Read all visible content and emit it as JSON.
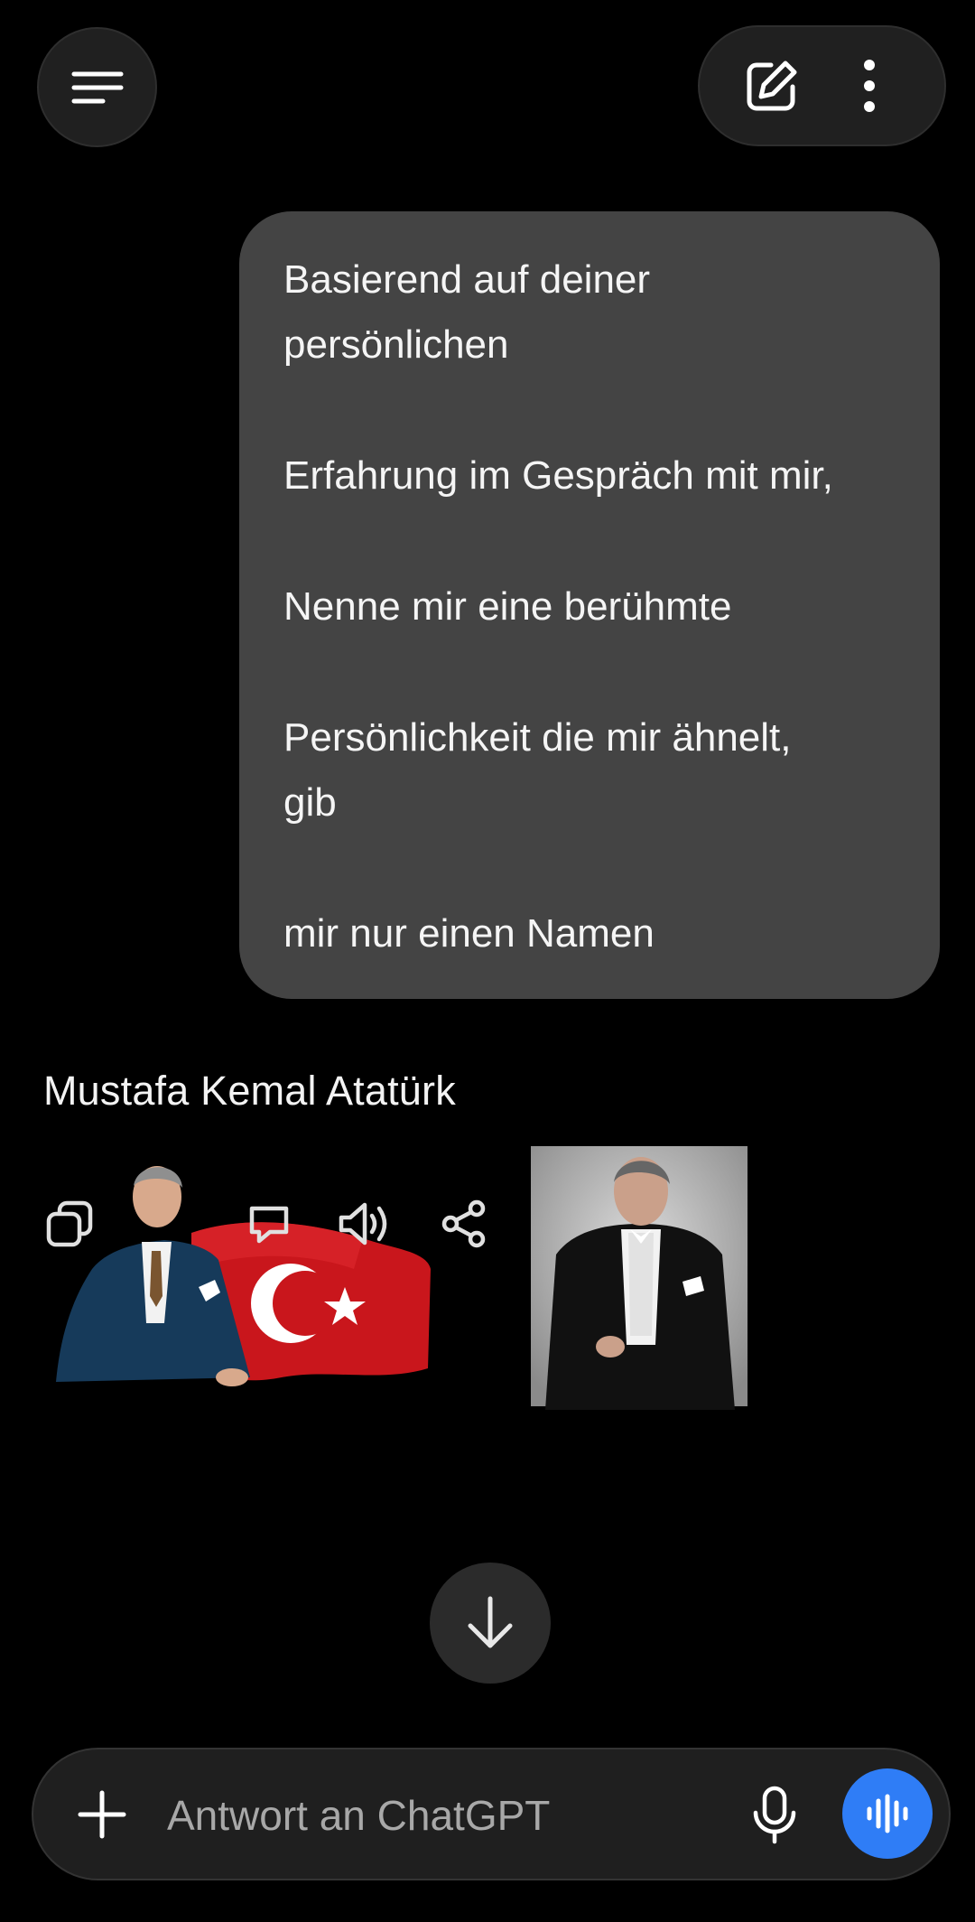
{
  "header": {
    "menu_icon": "menu-icon",
    "new_chat_icon": "edit-icon",
    "more_icon": "more-vertical-icon"
  },
  "conversation": {
    "user_message_lines": [
      "Basierend auf deiner",
      "persönlichen",
      "Erfahrung im Gespräch mit mir,",
      "Nenne mir eine berühmte",
      "Persönlichkeit die mir ähnelt,",
      "gib",
      "mir nur einen Namen"
    ],
    "assistant_reply": "Mustafa Kemal Atatürk",
    "action_icons": [
      "copy-icon",
      "feedback-icon",
      "read-aloud-icon",
      "share-icon"
    ],
    "images": [
      "portrait-with-flag",
      "portrait-in-tuxedo"
    ]
  },
  "scroll_down_icon": "arrow-down-icon",
  "composer": {
    "placeholder": "Antwort an ChatGPT",
    "value": "",
    "plus_icon": "plus-icon",
    "mic_icon": "microphone-icon",
    "voice_icon": "voice-mode-icon"
  },
  "colors": {
    "background": "#000000",
    "user_bubble": "#444444",
    "voice_button": "#2f7df6"
  }
}
